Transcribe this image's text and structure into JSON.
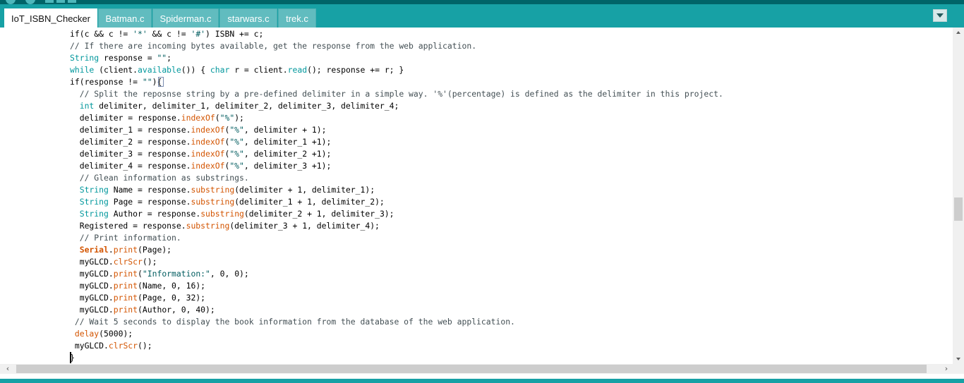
{
  "tabs": [
    {
      "label": "IoT_ISBN_Checker",
      "active": true
    },
    {
      "label": "Batman.c",
      "active": false
    },
    {
      "label": "Spiderman.c",
      "active": false
    },
    {
      "label": "starwars.c",
      "active": false
    },
    {
      "label": "trek.c",
      "active": false
    }
  ],
  "icons": {
    "tab_menu": "chevron-down-icon",
    "scroll_left": "chevron-left-icon",
    "scroll_right": "chevron-right-icon",
    "scroll_up": "arrow-up-icon",
    "scroll_down": "arrow-down-icon"
  },
  "colors": {
    "tab_bar": "#17a1a5",
    "top_strip": "#006468",
    "inactive_tab": "#61bcbf",
    "keyword": "#00979c",
    "function": "#d35400",
    "comment": "#434f54",
    "string": "#005c5f"
  },
  "code": {
    "lines": [
      [
        {
          "t": "if(c && c != "
        },
        {
          "t": "'*'",
          "c": "st"
        },
        {
          "t": " && c != "
        },
        {
          "t": "'#'",
          "c": "st"
        },
        {
          "t": ") ISBN += c;"
        }
      ],
      [
        {
          "t": "// If there are incoming bytes available, get the response from the web application.",
          "c": "cm"
        }
      ],
      [
        {
          "t": "String",
          "c": "kw"
        },
        {
          "t": " response = "
        },
        {
          "t": "\"\"",
          "c": "st"
        },
        {
          "t": ";"
        }
      ],
      [
        {
          "t": "while",
          "c": "kw"
        },
        {
          "t": " (client."
        },
        {
          "t": "available",
          "c": "kw"
        },
        {
          "t": "()) { "
        },
        {
          "t": "char",
          "c": "kw"
        },
        {
          "t": " r = client."
        },
        {
          "t": "read",
          "c": "kw"
        },
        {
          "t": "(); response += r; }"
        }
      ],
      [
        {
          "t": "if(response != "
        },
        {
          "t": "\"\"",
          "c": "st"
        },
        {
          "t": "){"
        }
      ],
      [
        {
          "t": "  "
        },
        {
          "t": "// Split the reposnse string by a pre-defined delimiter in a simple way. '%'(percentage) is defined as the delimiter in this project.",
          "c": "cm"
        }
      ],
      [
        {
          "t": "  "
        },
        {
          "t": "int",
          "c": "kw"
        },
        {
          "t": " delimiter, delimiter_1, delimiter_2, delimiter_3, delimiter_4;"
        }
      ],
      [
        {
          "t": "  delimiter = response."
        },
        {
          "t": "indexOf",
          "c": "fn"
        },
        {
          "t": "("
        },
        {
          "t": "\"%\"",
          "c": "st"
        },
        {
          "t": ");"
        }
      ],
      [
        {
          "t": "  delimiter_1 = response."
        },
        {
          "t": "indexOf",
          "c": "fn"
        },
        {
          "t": "("
        },
        {
          "t": "\"%\"",
          "c": "st"
        },
        {
          "t": ", delimiter + 1);"
        }
      ],
      [
        {
          "t": "  delimiter_2 = response."
        },
        {
          "t": "indexOf",
          "c": "fn"
        },
        {
          "t": "("
        },
        {
          "t": "\"%\"",
          "c": "st"
        },
        {
          "t": ", delimiter_1 +1);"
        }
      ],
      [
        {
          "t": "  delimiter_3 = response."
        },
        {
          "t": "indexOf",
          "c": "fn"
        },
        {
          "t": "("
        },
        {
          "t": "\"%\"",
          "c": "st"
        },
        {
          "t": ", delimiter_2 +1);"
        }
      ],
      [
        {
          "t": "  delimiter_4 = response."
        },
        {
          "t": "indexOf",
          "c": "fn"
        },
        {
          "t": "("
        },
        {
          "t": "\"%\"",
          "c": "st"
        },
        {
          "t": ", delimiter_3 +1);"
        }
      ],
      [
        {
          "t": "  "
        },
        {
          "t": "// Glean information as substrings.",
          "c": "cm"
        }
      ],
      [
        {
          "t": "  "
        },
        {
          "t": "String",
          "c": "kw"
        },
        {
          "t": " Name = response."
        },
        {
          "t": "substring",
          "c": "fn"
        },
        {
          "t": "(delimiter + 1, delimiter_1);"
        }
      ],
      [
        {
          "t": "  "
        },
        {
          "t": "String",
          "c": "kw"
        },
        {
          "t": " Page = response."
        },
        {
          "t": "substring",
          "c": "fn"
        },
        {
          "t": "(delimiter_1 + 1, delimiter_2);"
        }
      ],
      [
        {
          "t": "  "
        },
        {
          "t": "String",
          "c": "kw"
        },
        {
          "t": " Author = response."
        },
        {
          "t": "substring",
          "c": "fn"
        },
        {
          "t": "(delimiter_2 + 1, delimiter_3);"
        }
      ],
      [
        {
          "t": "  Registered = response."
        },
        {
          "t": "substring",
          "c": "fn"
        },
        {
          "t": "(delimiter_3 + 1, delimiter_4);"
        }
      ],
      [
        {
          "t": "  "
        },
        {
          "t": "// Print information.",
          "c": "cm"
        }
      ],
      [
        {
          "t": "  "
        },
        {
          "t": "Serial",
          "c": "ob"
        },
        {
          "t": "."
        },
        {
          "t": "print",
          "c": "fn"
        },
        {
          "t": "(Page);"
        }
      ],
      [
        {
          "t": "  myGLCD."
        },
        {
          "t": "clrScr",
          "c": "fn"
        },
        {
          "t": "();"
        }
      ],
      [
        {
          "t": "  myGLCD."
        },
        {
          "t": "print",
          "c": "fn"
        },
        {
          "t": "("
        },
        {
          "t": "\"Information:\"",
          "c": "st"
        },
        {
          "t": ", 0, 0);"
        }
      ],
      [
        {
          "t": "  myGLCD."
        },
        {
          "t": "print",
          "c": "fn"
        },
        {
          "t": "(Name, 0, 16);"
        }
      ],
      [
        {
          "t": "  myGLCD."
        },
        {
          "t": "print",
          "c": "fn"
        },
        {
          "t": "(Page, 0, 32);"
        }
      ],
      [
        {
          "t": "  myGLCD."
        },
        {
          "t": "print",
          "c": "fn"
        },
        {
          "t": "(Author, 0, 40);"
        }
      ],
      [
        {
          "t": " "
        },
        {
          "t": "// Wait 5 seconds to display the book information from the database of the web application.",
          "c": "cm"
        }
      ],
      [
        {
          "t": " "
        },
        {
          "t": "delay",
          "c": "fn"
        },
        {
          "t": "(5000);"
        }
      ],
      [
        {
          "t": " myGLCD."
        },
        {
          "t": "clrScr",
          "c": "fn"
        },
        {
          "t": "();"
        }
      ],
      [
        {
          "t": "}"
        }
      ]
    ]
  }
}
